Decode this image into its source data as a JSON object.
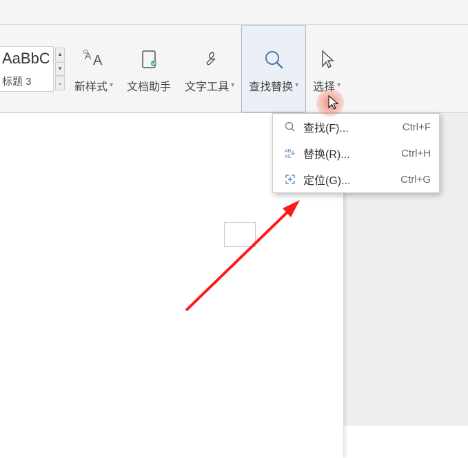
{
  "ribbon": {
    "style_preview": "AaBbCcDd",
    "style_name": "标题 3",
    "new_style": "新样式",
    "doc_helper": "文档助手",
    "text_tools": "文字工具",
    "find_replace": "查找替换",
    "select": "选择"
  },
  "menu": {
    "items": [
      {
        "label": "查找(F)...",
        "shortcut": "Ctrl+F",
        "icon": "search"
      },
      {
        "label": "替换(R)...",
        "shortcut": "Ctrl+H",
        "icon": "replace"
      },
      {
        "label": "定位(G)...",
        "shortcut": "Ctrl+G",
        "icon": "goto"
      }
    ]
  }
}
